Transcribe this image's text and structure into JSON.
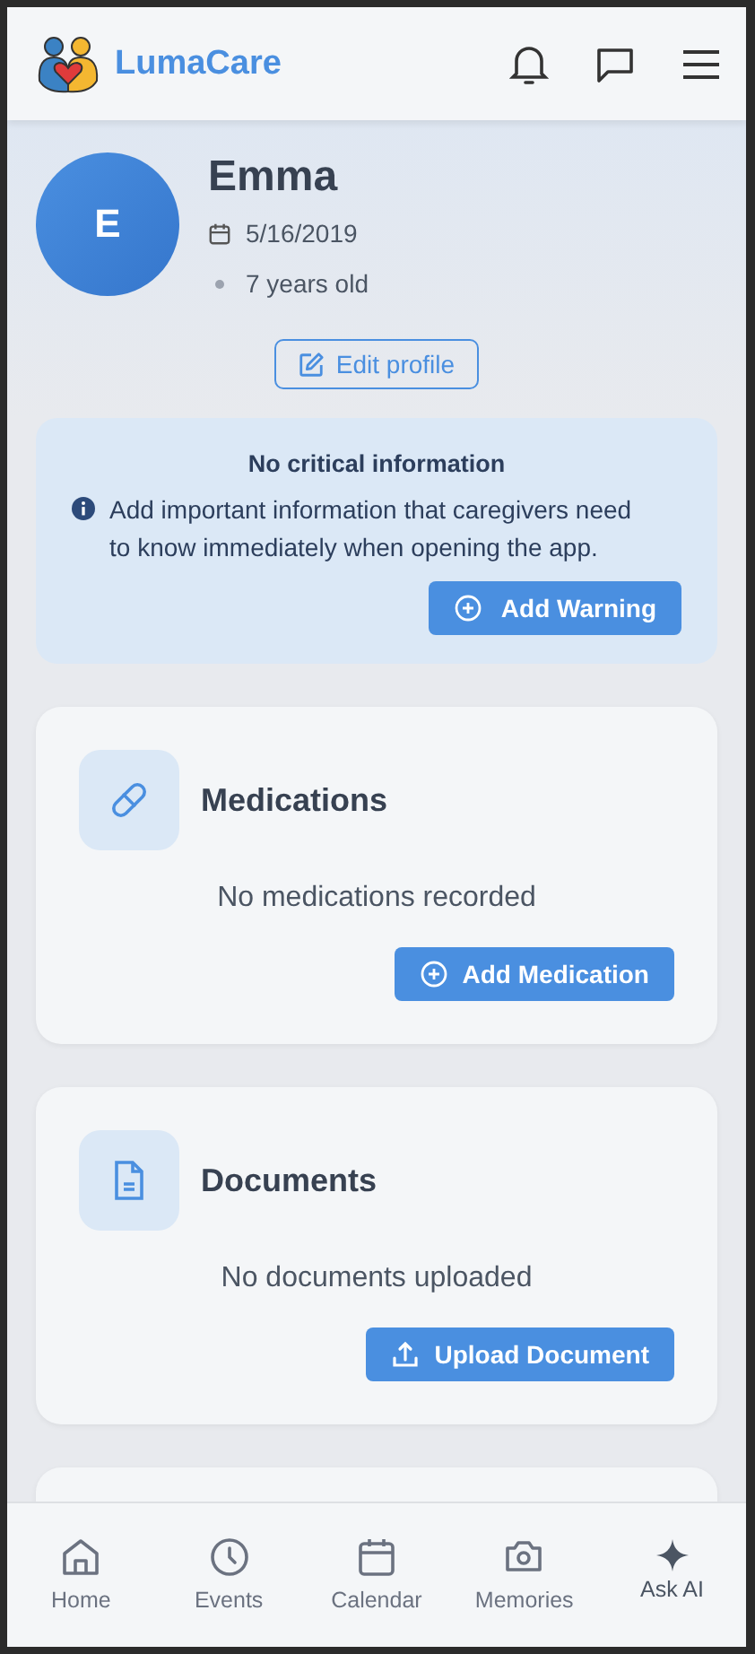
{
  "header": {
    "brand": "LumaCare"
  },
  "profile": {
    "initial": "E",
    "name": "Emma",
    "birthdate": "5/16/2019",
    "age": "7 years old",
    "edit_button": "Edit profile"
  },
  "notice": {
    "title": "No critical information",
    "text": "Add important information that caregivers need to know immediately when opening the app.",
    "button": "Add Warning"
  },
  "sections": [
    {
      "kind": "medications",
      "title": "Medications",
      "empty_text": "No medications recorded",
      "button": "Add Medication"
    },
    {
      "kind": "documents",
      "title": "Documents",
      "empty_text": "No documents uploaded",
      "button": "Upload Document"
    }
  ],
  "bottom_nav": [
    {
      "kind": "home",
      "label": "Home"
    },
    {
      "kind": "events",
      "label": "Events"
    },
    {
      "kind": "calendar",
      "label": "Calendar"
    },
    {
      "kind": "memories",
      "label": "Memories"
    },
    {
      "kind": "ai",
      "label": "Ask AI"
    }
  ]
}
